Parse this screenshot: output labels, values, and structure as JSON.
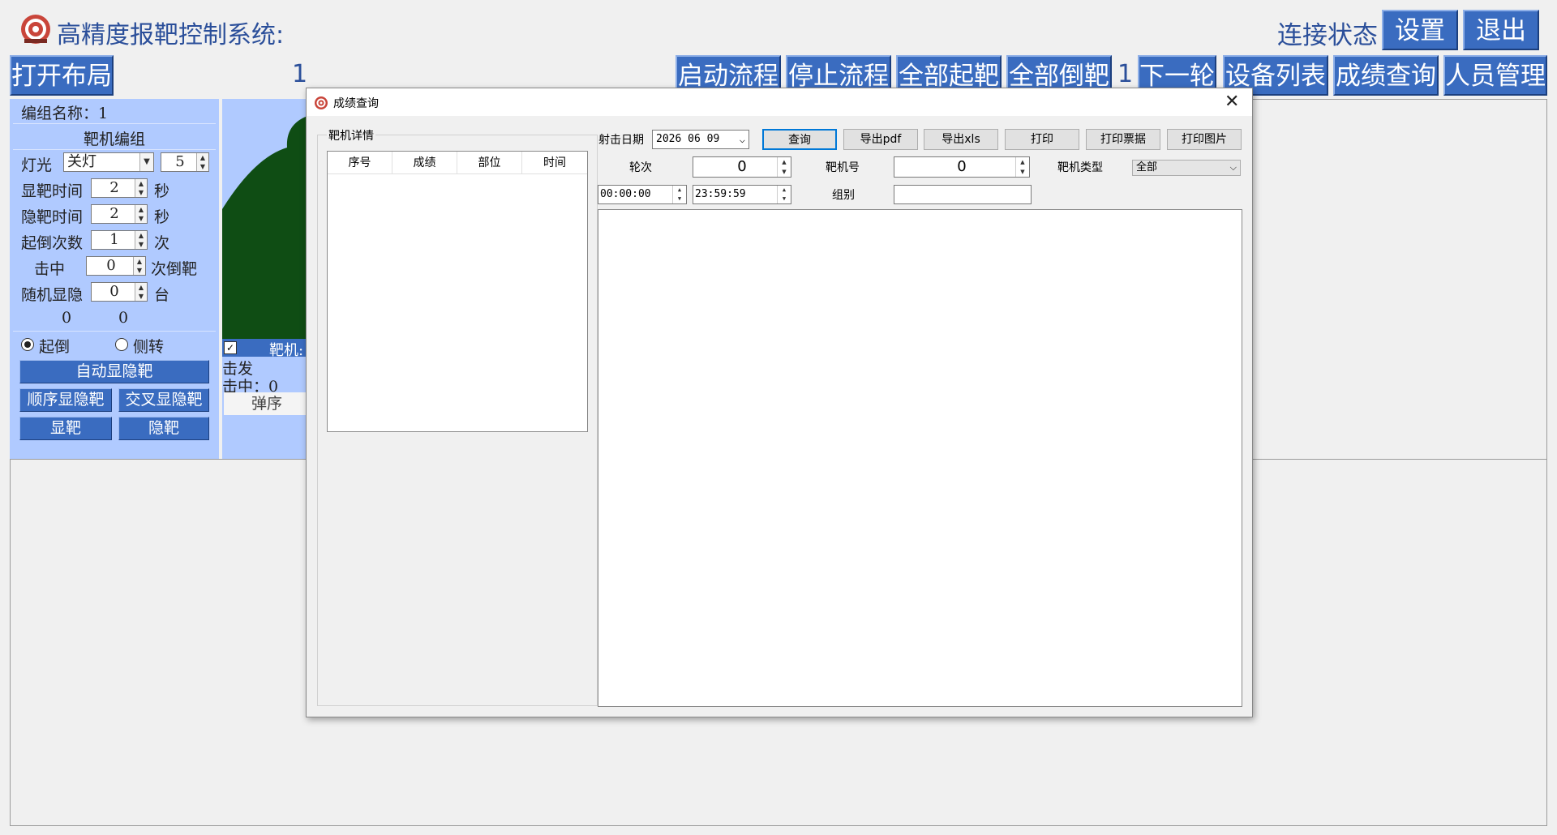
{
  "header": {
    "title": "高精度报靶控制系统:",
    "connection_label": "连接状态",
    "settings_button": "设置",
    "exit_button": "退出"
  },
  "toolbar": {
    "open_layout": "打开布局",
    "layout_number": "1",
    "start_flow": "启动流程",
    "stop_flow": "停止流程",
    "all_up": "全部起靶",
    "all_down": "全部倒靶",
    "round_number": "1",
    "next_round": "下一轮",
    "device_list": "设备列表",
    "score_query": "成绩查询",
    "personnel": "人员管理"
  },
  "left_panel": {
    "group_name": "编组名称：1",
    "section_title": "靶机编组",
    "light_label": "灯光",
    "light_value": "关灯",
    "light_number": "5",
    "show_time_label": "显靶时间",
    "show_time_value": "2",
    "show_time_unit": "秒",
    "hide_time_label": "隐靶时间",
    "hide_time_value": "2",
    "hide_time_unit": "秒",
    "updown_count_label": "起倒次数",
    "updown_count_value": "1",
    "updown_count_unit": "次",
    "hit_label": "击中",
    "hit_value": "0",
    "hit_unit": "次倒靶",
    "random_label": "随机显隐",
    "random_value": "0",
    "random_unit": "台",
    "counter_a": "0",
    "counter_b": "0",
    "radio_updown": "起倒",
    "radio_side": "侧转",
    "auto_btn": "自动显隐靶",
    "seq_btn": "顺序显隐靶",
    "cross_btn": "交叉显隐靶",
    "show_btn": "显靶",
    "hide_btn": "隐靶"
  },
  "target_card": {
    "name": "靶机:",
    "shots_label": "击发",
    "hits_label": "击中：0",
    "seq_label": "弹序"
  },
  "dialog": {
    "title": "成绩查询",
    "details_group": "靶机详情",
    "columns": [
      "序号",
      "成绩",
      "部位",
      "时间"
    ],
    "date_label": "射击日期",
    "date_value": "2026  06  09",
    "query_btn": "查询",
    "export_pdf": "导出pdf",
    "export_xls": "导出xls",
    "print": "打印",
    "print_ticket": "打印票据",
    "print_image": "打印图片",
    "round_label": "轮次",
    "round_value": "0",
    "target_no_label": "靶机号",
    "target_no_value": "0",
    "target_type_label": "靶机类型",
    "target_type_value": "全部",
    "time_from": "00:00:00",
    "time_to": "23:59:59",
    "group_label": "组别",
    "group_value": ""
  },
  "colors": {
    "accent_blue": "#3a6cc0",
    "panel_blue": "#b0caff",
    "title_blue": "#2b4f9a",
    "target_green": "#0f4d14"
  }
}
